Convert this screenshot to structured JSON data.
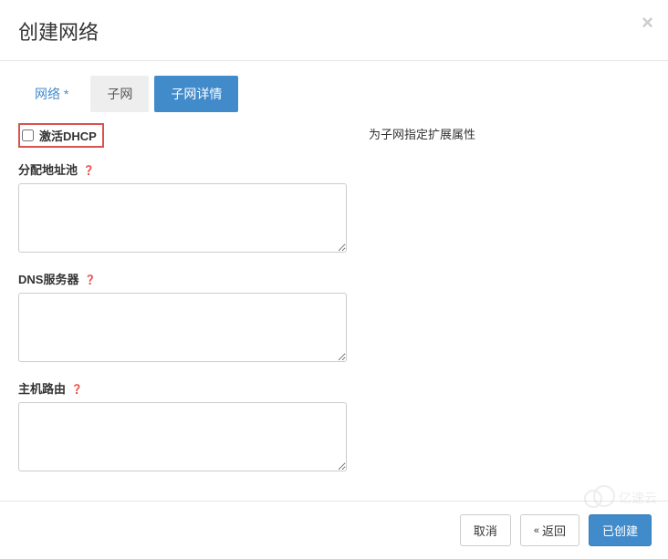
{
  "modal": {
    "title": "创建网络",
    "close_glyph": "×"
  },
  "tabs": {
    "network": "网络",
    "subnet": "子网",
    "subnet_details": "子网详情"
  },
  "form": {
    "enable_dhcp_label": "激活DHCP",
    "help_text": "为子网指定扩展属性",
    "allocation_pools_label": "分配地址池",
    "dns_servers_label": "DNS服务器",
    "host_routes_label": "主机路由",
    "help_glyph": "❓"
  },
  "footer": {
    "cancel": "取消",
    "back": "返回",
    "back_icon": "«",
    "submit": "已创建"
  },
  "watermark": {
    "text": "亿速云"
  }
}
